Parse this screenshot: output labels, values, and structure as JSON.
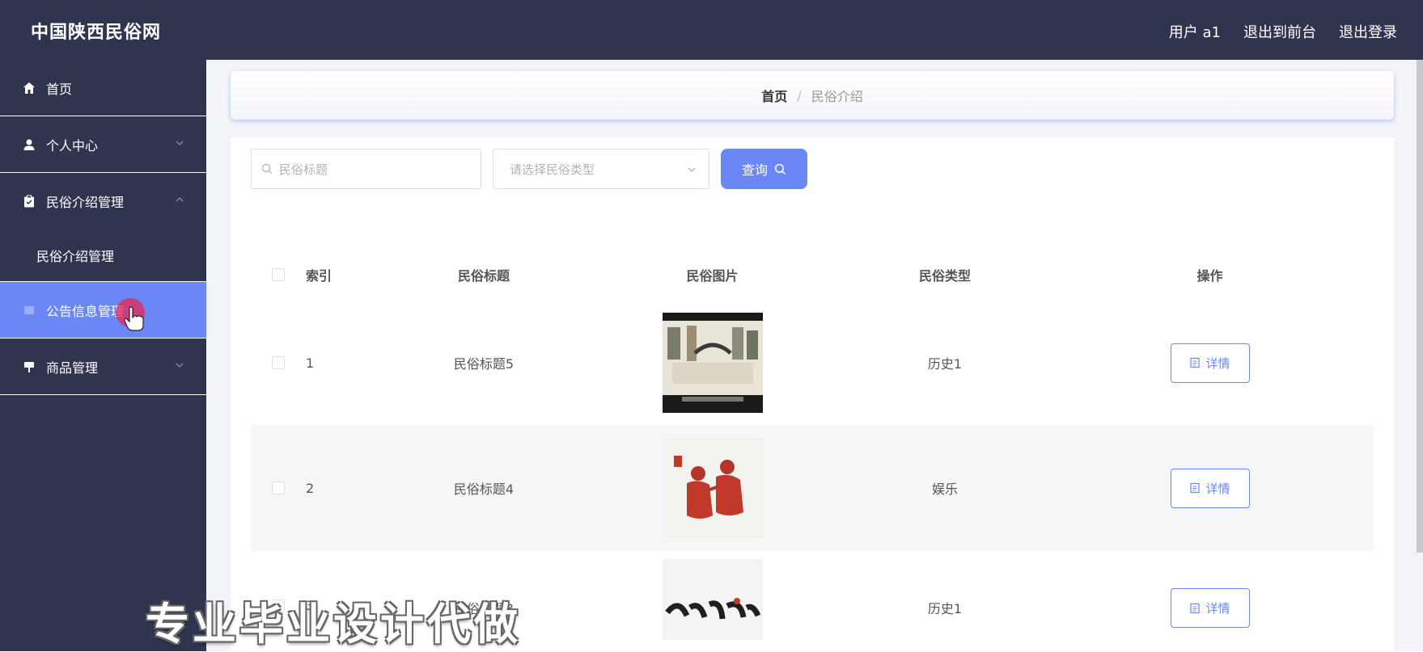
{
  "header": {
    "brand": "中国陕西民俗网",
    "user_label": "用户 a1",
    "exit_front_label": "退出到前台",
    "logout_label": "退出登录"
  },
  "sidebar": {
    "items": [
      {
        "label": "首页",
        "icon": "home-icon"
      },
      {
        "label": "个人中心",
        "icon": "user-icon"
      },
      {
        "label": "民俗介绍管理",
        "icon": "clipboard-icon"
      },
      {
        "label": "民俗介绍管理"
      },
      {
        "label": "公告信息管理",
        "icon": "notice-icon"
      },
      {
        "label": "商品管理",
        "icon": "goods-icon"
      }
    ]
  },
  "breadcrumb": {
    "home": "首页",
    "separator": "/",
    "current": "民俗介绍"
  },
  "search": {
    "title_placeholder": "民俗标题",
    "type_placeholder": "请选择民俗类型",
    "query_label": "查询"
  },
  "table": {
    "headers": {
      "index": "索引",
      "title": "民俗标题",
      "image": "民俗图片",
      "type": "民俗类型",
      "action": "操作"
    },
    "rows": [
      {
        "index": "1",
        "title": "民俗标题5",
        "type": "历史1",
        "action": "详情"
      },
      {
        "index": "2",
        "title": "民俗标题4",
        "type": "娱乐",
        "action": "详情"
      },
      {
        "index": "3",
        "title": "民俗标题3",
        "type": "历史1",
        "action": "详情"
      }
    ]
  },
  "watermark": "专业毕业设计代做",
  "colors": {
    "header_bg": "#30344f",
    "accent": "#6b87f5",
    "pointer": "#e62850"
  }
}
